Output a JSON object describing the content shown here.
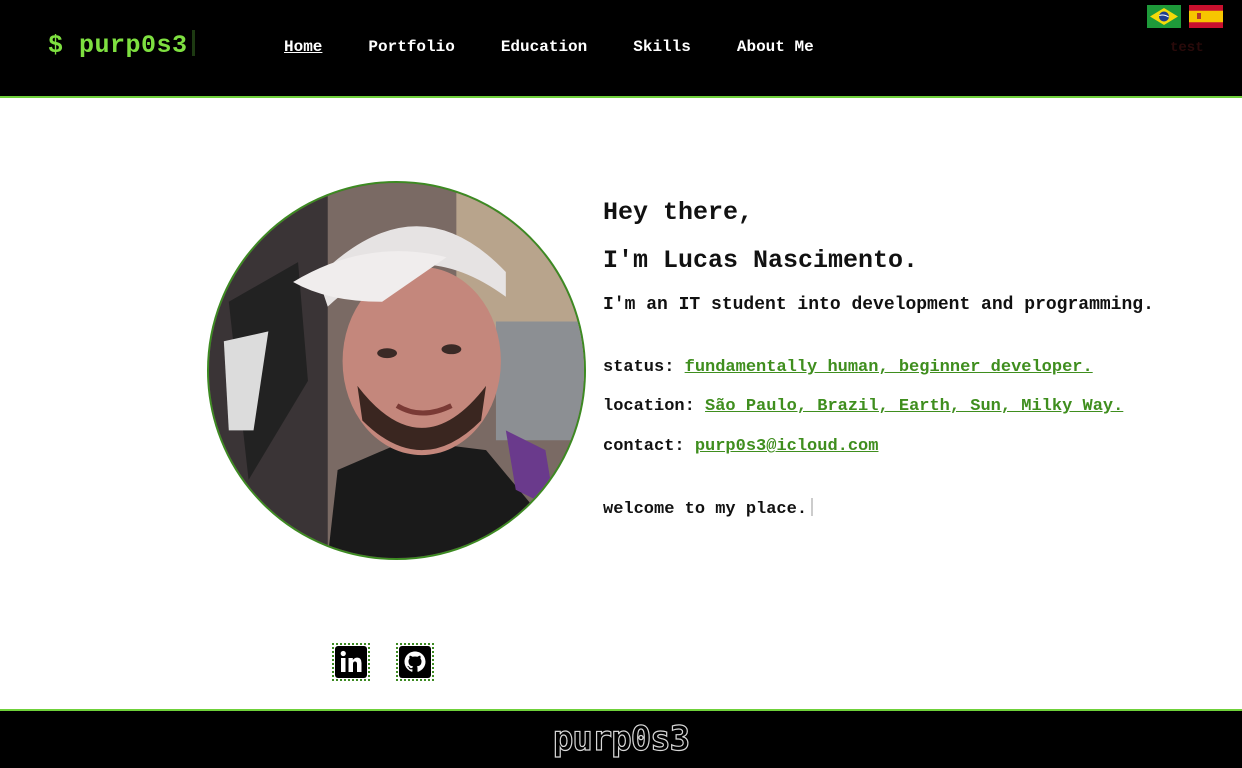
{
  "header": {
    "logo": "$ purp0s3",
    "nav": [
      "Home",
      "Portfolio",
      "Education",
      "Skills",
      "About Me"
    ],
    "active_nav": "Home",
    "languages": [
      "pt-BR flag",
      "es flag"
    ],
    "test_label": "test",
    "accent_color": "#7ee040"
  },
  "profile": {
    "greeting_line1": "Hey there,",
    "greeting_line2": "I'm Lucas Nascimento.",
    "tagline": "I'm an IT student into development and programming.",
    "status_label": "status:",
    "status_value": "fundamentally human, beginner developer.",
    "location_label": "location:",
    "location_value": "São Paulo, Brazil, Earth, Sun, Milky Way.",
    "contact_label": "contact:",
    "contact_value": "purp0s3@icloud.com",
    "welcome": "welcome to my place."
  },
  "social": {
    "icons": [
      "linkedin-icon",
      "github-icon"
    ]
  },
  "footer": {
    "logo": "purp0s3"
  }
}
